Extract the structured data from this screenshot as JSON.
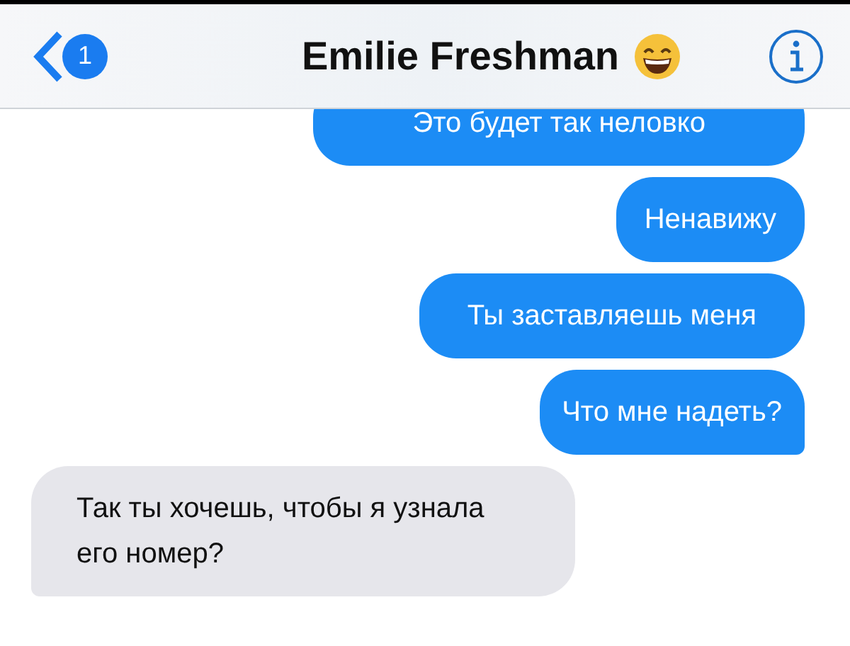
{
  "header": {
    "back_badge": "1",
    "title": "Emilie Freshman"
  },
  "messages": [
    {
      "kind": "sent",
      "text": "Это будет так неловко",
      "tail": false
    },
    {
      "kind": "sent",
      "text": "Ненавижу",
      "tail": false
    },
    {
      "kind": "sent",
      "text": "Ты заставляешь меня",
      "tail": false
    },
    {
      "kind": "sent",
      "text": "Что мне надеть?",
      "tail": true
    },
    {
      "kind": "received",
      "text": "Так ты хочешь, чтобы я узнала его номер?",
      "tail": true
    }
  ]
}
